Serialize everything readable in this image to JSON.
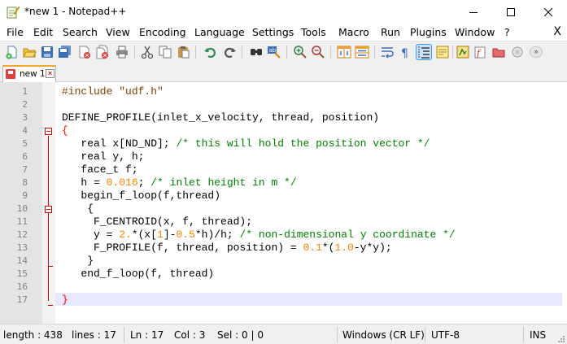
{
  "window": {
    "title": "*new 1 - Notepad++",
    "controls": [
      "minimize-icon",
      "maximize-icon",
      "close-icon"
    ]
  },
  "menu": {
    "items": [
      "File",
      "Edit",
      "Search",
      "View",
      "Encoding",
      "Language",
      "Settings",
      "Tools",
      "Macro",
      "Run",
      "Plugins",
      "Window",
      "?"
    ],
    "close_label": "X"
  },
  "toolbar": {
    "icons": [
      "new-file-icon",
      "open-file-icon",
      "save-icon",
      "save-all-icon",
      "close-icon",
      "close-all-icon",
      "print-icon",
      "cut-icon",
      "copy-icon",
      "paste-icon",
      "undo-icon",
      "redo-icon",
      "find-icon",
      "replace-icon",
      "zoom-in-icon",
      "zoom-out-icon",
      "sync-vertical-icon",
      "sync-horizontal-icon",
      "word-wrap-icon",
      "show-all-chars-icon",
      "indent-guide-icon",
      "doc-map-icon",
      "function-list-icon",
      "folder-workspace-icon",
      "monitoring-icon",
      "record-macro-icon",
      "stop-macro-icon"
    ],
    "more_label": "»"
  },
  "tabs": [
    {
      "label": "new 1",
      "modified": true
    }
  ],
  "editor": {
    "current_line": 17,
    "lines": [
      {
        "n": "1",
        "tokens": [
          {
            "t": "#include \"udf.h\"",
            "c": "pp"
          }
        ]
      },
      {
        "n": "2",
        "tokens": []
      },
      {
        "n": "3",
        "tokens": [
          {
            "t": "DEFINE_PROFILE(inlet_x_velocity, thread, position)",
            "c": ""
          }
        ]
      },
      {
        "n": "4",
        "tokens": [
          {
            "t": "{",
            "c": "rbr"
          }
        ]
      },
      {
        "n": "5",
        "tokens": [
          {
            "t": "   real x[ND_ND]; ",
            "c": ""
          },
          {
            "t": "/* this will hold the position vector */",
            "c": "cm"
          }
        ]
      },
      {
        "n": "6",
        "tokens": [
          {
            "t": "   real y, h;",
            "c": ""
          }
        ]
      },
      {
        "n": "7",
        "tokens": [
          {
            "t": "   face_t f;",
            "c": ""
          }
        ]
      },
      {
        "n": "8",
        "tokens": [
          {
            "t": "   h = ",
            "c": ""
          },
          {
            "t": "0.016",
            "c": "nm"
          },
          {
            "t": "; ",
            "c": ""
          },
          {
            "t": "/* inlet height in m */",
            "c": "cm"
          }
        ]
      },
      {
        "n": "9",
        "tokens": [
          {
            "t": "   begin_f_loop(f,thread)",
            "c": ""
          }
        ]
      },
      {
        "n": "10",
        "tokens": [
          {
            "t": "    {",
            "c": ""
          }
        ]
      },
      {
        "n": "11",
        "tokens": [
          {
            "t": "     F_CENTROID(x, f, thread);",
            "c": ""
          }
        ]
      },
      {
        "n": "12",
        "tokens": [
          {
            "t": "     y = ",
            "c": ""
          },
          {
            "t": "2.",
            "c": "nm"
          },
          {
            "t": "*(x[",
            "c": ""
          },
          {
            "t": "1",
            "c": "nm"
          },
          {
            "t": "]-",
            "c": ""
          },
          {
            "t": "0.5",
            "c": "nm"
          },
          {
            "t": "*h)/h; ",
            "c": ""
          },
          {
            "t": "/* non-dimensional y coordinate */",
            "c": "cm"
          }
        ]
      },
      {
        "n": "13",
        "tokens": [
          {
            "t": "     F_PROFILE(f, thread, position) = ",
            "c": ""
          },
          {
            "t": "0.1",
            "c": "nm"
          },
          {
            "t": "*(",
            "c": ""
          },
          {
            "t": "1.0",
            "c": "nm"
          },
          {
            "t": "-y*y);",
            "c": ""
          }
        ]
      },
      {
        "n": "14",
        "tokens": [
          {
            "t": "    }",
            "c": ""
          }
        ]
      },
      {
        "n": "15",
        "tokens": [
          {
            "t": "   end_f_loop(f, thread)",
            "c": ""
          }
        ]
      },
      {
        "n": "16",
        "tokens": []
      },
      {
        "n": "17",
        "tokens": [
          {
            "t": "}",
            "c": "rbr"
          }
        ]
      }
    ]
  },
  "status": {
    "length": "length : 438",
    "lines": "lines : 17",
    "ln": "Ln : 17",
    "col": "Col : 3",
    "sel": "Sel : 0 | 0",
    "eol": "Windows (CR LF)",
    "encoding": "UTF-8",
    "mode": "INS"
  },
  "colors": {
    "preprocessor": "#804000",
    "comment": "#008000",
    "number": "#ff8000",
    "brace_match": "#ff0000",
    "current_line": "#e8e8ff",
    "fold_marker": "#d00000",
    "tab_accent": "#f7a824"
  }
}
